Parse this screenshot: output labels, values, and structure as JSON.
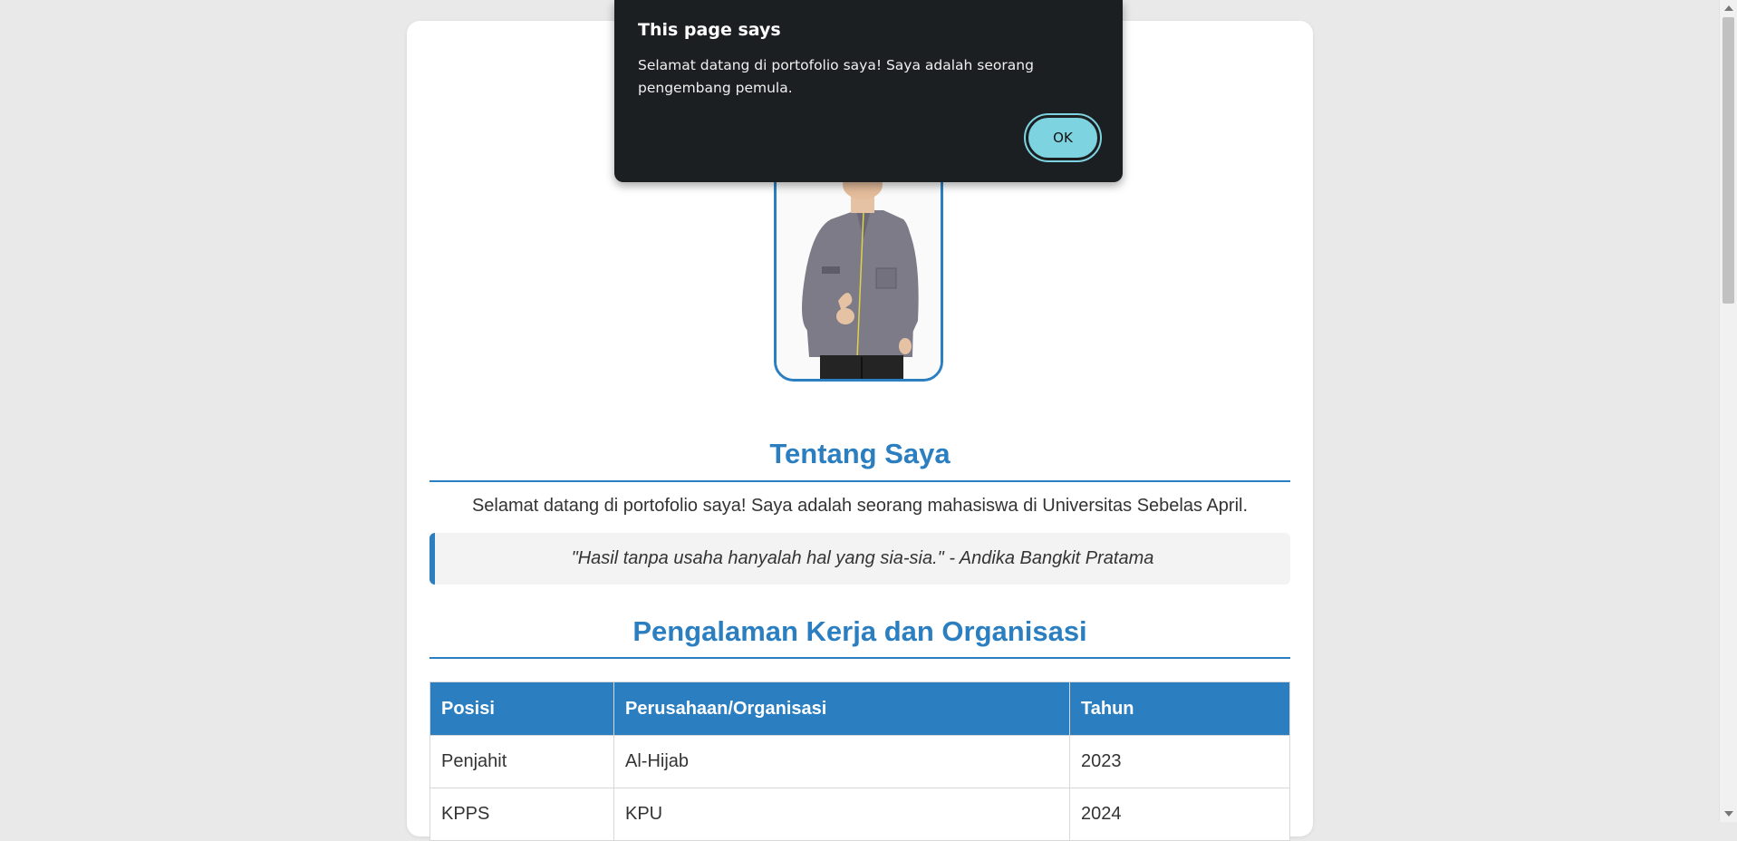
{
  "about": {
    "title": "Tentang Saya",
    "intro": "Selamat datang di portofolio saya! Saya adalah seorang mahasiswa di Universitas Sebelas April.",
    "quote": "\"Hasil tanpa usaha hanyalah hal yang sia-sia.\" - Andika Bangkit Pratama"
  },
  "experience": {
    "title": "Pengalaman Kerja dan Organisasi",
    "headers": [
      "Posisi",
      "Perusahaan/Organisasi",
      "Tahun"
    ],
    "rows": [
      [
        "Penjahit",
        "Al-Hijab",
        "2023"
      ],
      [
        "KPPS",
        "KPU",
        "2024"
      ]
    ]
  },
  "dialog": {
    "title": "This page says",
    "message": "Selamat datang di portofolio saya! Saya adalah seorang pengembang pemula.",
    "ok_label": "OK"
  },
  "colors": {
    "accent": "#2b7fc1",
    "dialog_bg": "#1b1f21",
    "ok_button": "#7ed3e0",
    "page_bg": "#e9e9e9"
  }
}
